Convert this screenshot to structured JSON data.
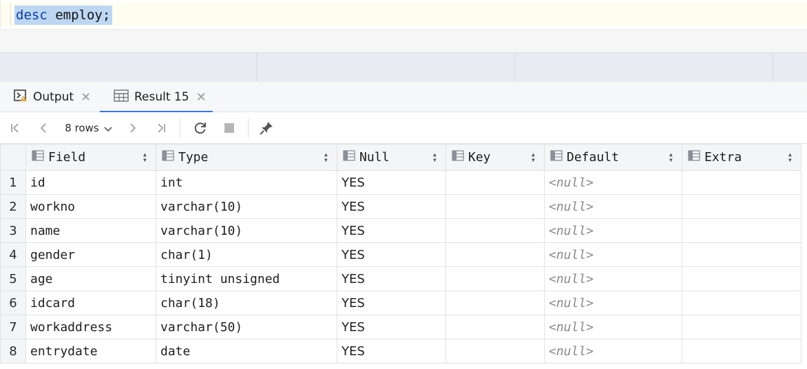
{
  "editor": {
    "keyword": "desc",
    "identifier": " employ;"
  },
  "tabs": [
    {
      "label": "Output",
      "icon": "console-output-icon"
    },
    {
      "label": "Result 15",
      "icon": "table-grid-icon",
      "active": true
    }
  ],
  "toolbar": {
    "rows_label": "8 rows"
  },
  "columns": [
    {
      "label": "Field"
    },
    {
      "label": "Type"
    },
    {
      "label": "Null"
    },
    {
      "label": "Key"
    },
    {
      "label": "Default"
    },
    {
      "label": "Extra"
    }
  ],
  "rows": [
    {
      "num": "1",
      "field": "id",
      "type": "int",
      "null": "YES",
      "key": "",
      "default": "<null>",
      "extra": ""
    },
    {
      "num": "2",
      "field": "workno",
      "type": "varchar(10)",
      "null": "YES",
      "key": "",
      "default": "<null>",
      "extra": ""
    },
    {
      "num": "3",
      "field": "name",
      "type": "varchar(10)",
      "null": "YES",
      "key": "",
      "default": "<null>",
      "extra": ""
    },
    {
      "num": "4",
      "field": "gender",
      "type": "char(1)",
      "null": "YES",
      "key": "",
      "default": "<null>",
      "extra": ""
    },
    {
      "num": "5",
      "field": "age",
      "type": "tinyint unsigned",
      "null": "YES",
      "key": "",
      "default": "<null>",
      "extra": ""
    },
    {
      "num": "6",
      "field": "idcard",
      "type": "char(18)",
      "null": "YES",
      "key": "",
      "default": "<null>",
      "extra": ""
    },
    {
      "num": "7",
      "field": "workaddress",
      "type": "varchar(50)",
      "null": "YES",
      "key": "",
      "default": "<null>",
      "extra": ""
    },
    {
      "num": "8",
      "field": "entrydate",
      "type": "date",
      "null": "YES",
      "key": "",
      "default": "<null>",
      "extra": ""
    }
  ],
  "colors": {
    "accent": "#3574f0",
    "selection": "#bdd7f3",
    "keyword": "#0a3aa8"
  }
}
